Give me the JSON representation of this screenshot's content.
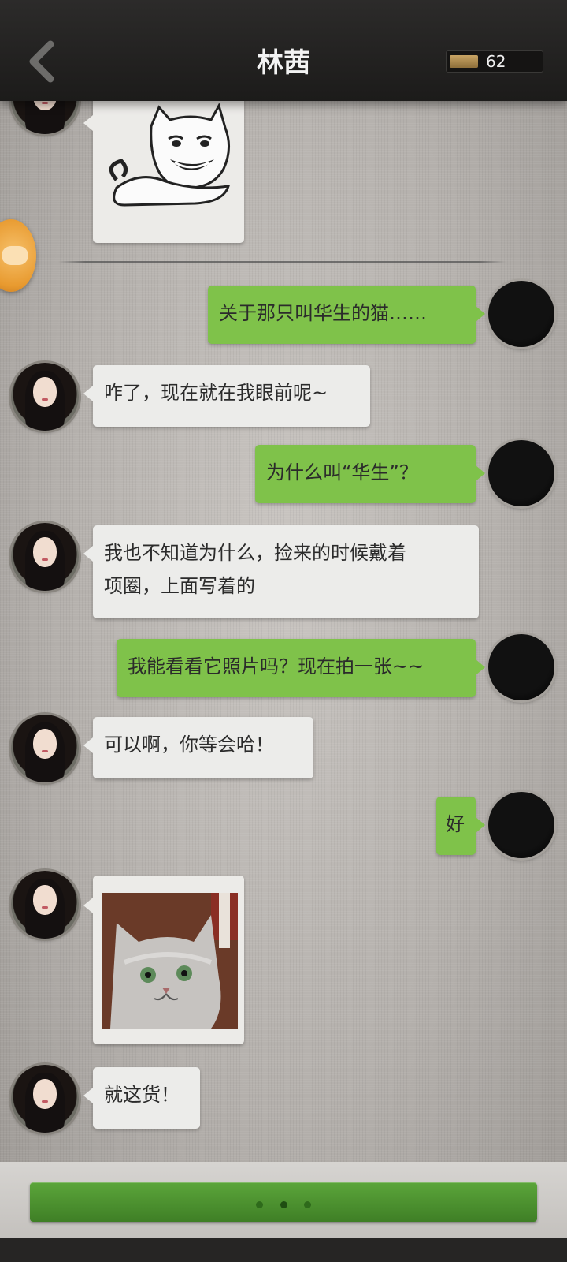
{
  "header": {
    "title": "林茜",
    "counter_value": "62",
    "back_icon": "chevron-left-icon"
  },
  "messages": [
    {
      "side": "left",
      "type": "sticker",
      "description_icon": "meme-sticker-icon"
    },
    {
      "side": "right",
      "type": "text",
      "text": "关于那只叫华生的猫……"
    },
    {
      "side": "left",
      "type": "text",
      "text": "咋了，现在就在我眼前呢~"
    },
    {
      "side": "right",
      "type": "text",
      "text": "为什么叫“华生”？"
    },
    {
      "side": "left",
      "type": "text",
      "lines": [
        "我也不知道为什么，捡来的时候戴着",
        "项圈，上面写着的"
      ]
    },
    {
      "side": "right",
      "type": "text",
      "text": "我能看看它照片吗？现在拍一张~~"
    },
    {
      "side": "left",
      "type": "text",
      "text": "可以啊，你等会哈！"
    },
    {
      "side": "right",
      "type": "text",
      "text": "好"
    },
    {
      "side": "left",
      "type": "photo",
      "description_icon": "cat-photo-icon"
    },
    {
      "side": "left",
      "type": "text",
      "text": "就这货！"
    }
  ],
  "float_button": {
    "icon": "gamepad-icon"
  },
  "pager": {
    "count": 3,
    "active_index": 1
  },
  "colors": {
    "header_bg": "#1f1e1d",
    "right_bubble": "#7fc24a",
    "left_bubble": "#ececea",
    "action_bar": "#4a9130"
  }
}
